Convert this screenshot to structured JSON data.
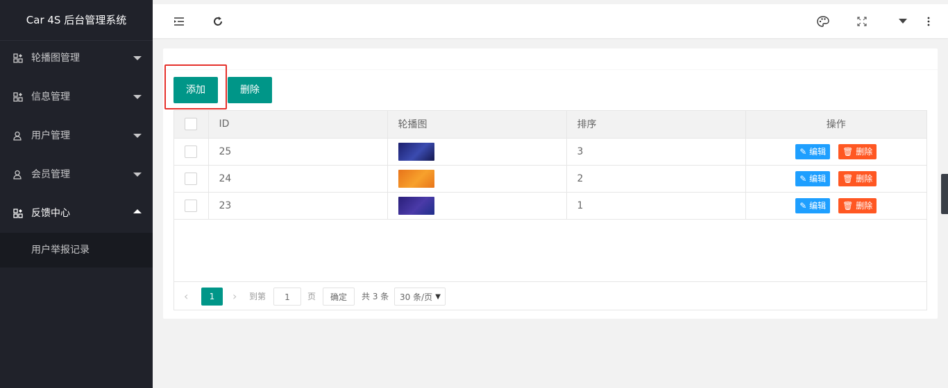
{
  "app": {
    "title": "Car 4S 后台管理系统"
  },
  "sidebar": {
    "items": [
      {
        "label": "轮播图管理",
        "icon": "grid-icon",
        "open": false
      },
      {
        "label": "信息管理",
        "icon": "grid-icon",
        "open": false
      },
      {
        "label": "用户管理",
        "icon": "user-icon",
        "open": false
      },
      {
        "label": "会员管理",
        "icon": "user-icon",
        "open": false
      },
      {
        "label": "反馈中心",
        "icon": "grid-icon",
        "open": true
      }
    ],
    "subitems": [
      {
        "label": "用户举报记录"
      }
    ]
  },
  "header": {
    "icons": [
      "menu-fold-icon",
      "refresh-icon",
      "palette-icon",
      "fullscreen-icon",
      "dropdown-icon",
      "more-vertical-icon"
    ]
  },
  "toolbar": {
    "add_label": "添加",
    "delete_label": "删除"
  },
  "table": {
    "columns": [
      "ID",
      "轮播图",
      "排序",
      "操作"
    ],
    "rows": [
      {
        "id": "25",
        "sort": "3",
        "thumb_color": "#2a2f86"
      },
      {
        "id": "24",
        "sort": "2",
        "thumb_color": "#f08a1d"
      },
      {
        "id": "23",
        "sort": "1",
        "thumb_color": "#3b2d8f"
      }
    ],
    "edit_label": "编辑",
    "delete_label": "删除"
  },
  "pager": {
    "current": "1",
    "goto_prefix": "到第",
    "goto_value": "1",
    "goto_suffix": "页",
    "confirm_label": "确定",
    "total_text": "共 3 条",
    "page_size": "30 条/页"
  },
  "colors": {
    "primary": "#009688",
    "edit": "#1e9fff",
    "danger": "#ff5722",
    "sidebar": "#20222a",
    "highlight": "#e5302a"
  }
}
